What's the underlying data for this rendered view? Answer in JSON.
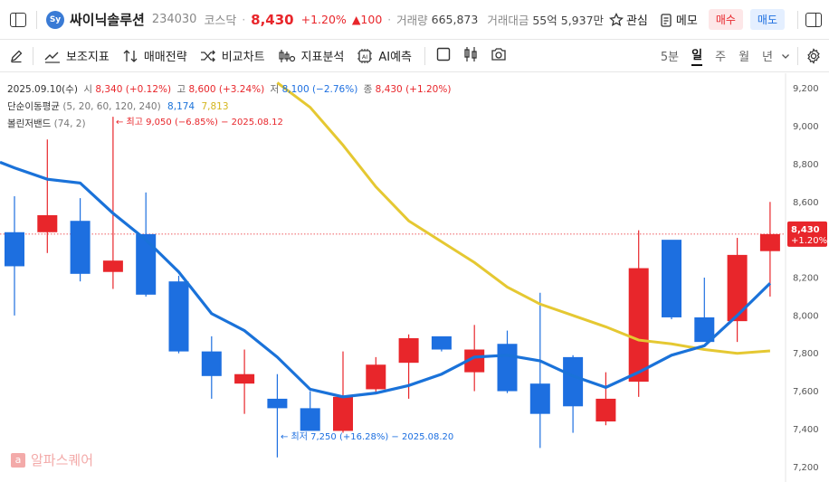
{
  "header": {
    "logo_text": "Sy",
    "name": "싸이닉솔루션",
    "code": "234030",
    "market": "코스닥",
    "price": "8,430",
    "change_pct": "+1.20%",
    "change_amt": "▲100",
    "volume_label": "거래량",
    "volume": "665,873",
    "amount_label": "거래대금",
    "amount": "55억 5,937만",
    "watch_label": "관심",
    "memo_label": "메모",
    "buy_label": "매수",
    "sell_label": "매도"
  },
  "toolbar": {
    "indicators": "보조지표",
    "strategy": "매매전략",
    "compare": "비교차트",
    "analysis": "지표분석",
    "ai": "AI예측",
    "periods": [
      "5분",
      "일",
      "주",
      "월",
      "년"
    ],
    "active_period": "일"
  },
  "legend": {
    "date": "2025.09.10(수)",
    "open_label": "시",
    "open": "8,340 (+0.12%)",
    "high_label": "고",
    "high": "8,600 (+3.24%)",
    "low_label": "저",
    "low": "8,100 (−2.76%)",
    "close_label": "종",
    "close": "8,430 (+1.20%)",
    "ma_label": "단순이동평균",
    "ma_params": "(5, 20, 60, 120, 240)",
    "ma5_value": "8,174",
    "ma20_value": "7,813",
    "bb_label": "볼린저밴드",
    "bb_params": "(74, 2)"
  },
  "annotations": {
    "high": "← 최고 9,050 (−6.85%) − 2025.08.12",
    "low": "← 최저 7,250 (+16.28%) − 2025.08.20"
  },
  "price_tag": {
    "price": "8,430",
    "pct": "+1.20%"
  },
  "watermark": {
    "icon": "a",
    "text": "알파스퀘어"
  },
  "colors": {
    "up": "#e8262b",
    "down": "#1d6fe0",
    "ma5": "#1a72d9",
    "ma20": "#e5c832"
  },
  "chart_data": {
    "type": "candlestick",
    "y_ticks": [
      9200,
      9000,
      8800,
      8600,
      8400,
      8200,
      8000,
      7800,
      7600,
      7400,
      7200
    ],
    "ylim": [
      7120,
      9280
    ],
    "candles": [
      {
        "o": 8440,
        "h": 8630,
        "l": 8000,
        "c": 8260
      },
      {
        "o": 8440,
        "h": 8930,
        "l": 8330,
        "c": 8530
      },
      {
        "o": 8500,
        "h": 8620,
        "l": 8180,
        "c": 8220
      },
      {
        "o": 8230,
        "h": 9050,
        "l": 8140,
        "c": 8290
      },
      {
        "o": 8430,
        "h": 8650,
        "l": 8100,
        "c": 8110
      },
      {
        "o": 8180,
        "h": 8210,
        "l": 7800,
        "c": 7810
      },
      {
        "o": 7810,
        "h": 7890,
        "l": 7560,
        "c": 7680
      },
      {
        "o": 7640,
        "h": 7820,
        "l": 7480,
        "c": 7690
      },
      {
        "o": 7560,
        "h": 7690,
        "l": 7250,
        "c": 7510
      },
      {
        "o": 7510,
        "h": 7600,
        "l": 7400,
        "c": 7390
      },
      {
        "o": 7390,
        "h": 7810,
        "l": 7380,
        "c": 7570
      },
      {
        "o": 7610,
        "h": 7780,
        "l": 7590,
        "c": 7740
      },
      {
        "o": 7750,
        "h": 7900,
        "l": 7560,
        "c": 7880
      },
      {
        "o": 7890,
        "h": 7880,
        "l": 7810,
        "c": 7820
      },
      {
        "o": 7700,
        "h": 7950,
        "l": 7600,
        "c": 7820
      },
      {
        "o": 7850,
        "h": 7920,
        "l": 7590,
        "c": 7600
      },
      {
        "o": 7640,
        "h": 8120,
        "l": 7300,
        "c": 7480
      },
      {
        "o": 7780,
        "h": 7790,
        "l": 7380,
        "c": 7520
      },
      {
        "o": 7440,
        "h": 7700,
        "l": 7420,
        "c": 7560
      },
      {
        "o": 7650,
        "h": 8450,
        "l": 7570,
        "c": 8250
      },
      {
        "o": 8400,
        "h": 8340,
        "l": 7980,
        "c": 7990
      },
      {
        "o": 7990,
        "h": 8200,
        "l": 7880,
        "c": 7860
      },
      {
        "o": 7970,
        "h": 8410,
        "l": 7860,
        "c": 8320
      },
      {
        "o": 8340,
        "h": 8600,
        "l": 8100,
        "c": 8430
      }
    ],
    "ma5": [
      8780,
      8720,
      8700,
      8540,
      8400,
      8230,
      8010,
      7920,
      7780,
      7610,
      7570,
      7590,
      7630,
      7690,
      7780,
      7790,
      7760,
      7680,
      7620,
      7700,
      7790,
      7840,
      8000,
      8170
    ],
    "ma20": [
      null,
      null,
      null,
      null,
      null,
      null,
      null,
      null,
      9230,
      9100,
      8900,
      8680,
      8500,
      8390,
      8280,
      8150,
      8060,
      8000,
      7940,
      7870,
      7850,
      7820,
      7800,
      7813
    ],
    "current_price": 8430
  }
}
